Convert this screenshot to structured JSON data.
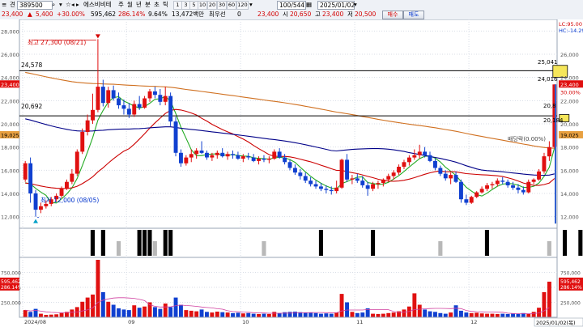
{
  "toolbar": {
    "menu_glyph": "≡",
    "period_prefix": "견",
    "code": "389500",
    "stock_name": "에스비비테",
    "period_tabs": [
      "주",
      "월",
      "년",
      "분",
      "초",
      "틱"
    ],
    "minute_buttons": [
      "1",
      "3",
      "5",
      "10",
      "20",
      "30",
      "60",
      "120"
    ],
    "count": "100/544",
    "date": "2025/01/02",
    "buy_label": "매수",
    "sell_label": "매도"
  },
  "quote": {
    "price": "23,400",
    "change": "5,400",
    "change_rate": "+30.00%",
    "volume": "595,462",
    "volume_ratio": "286.14%",
    "turnover_rate": "9.64%",
    "trade_value": "13,472백만",
    "priority_label": "최우선",
    "priority_value": "0",
    "open_label_value": "23,400",
    "high_label": "시",
    "high_value": "20,650",
    "close_label": "고",
    "close_value": "23,400",
    "low_label": "저",
    "low_value": "20,500"
  },
  "price_axis": {
    "left_ticks": [
      "28,000",
      "26,000",
      "24,000",
      "22,000",
      "20,000",
      "18,000",
      "16,000",
      "14,000",
      "12,000"
    ],
    "right_ticks": [
      "26,000",
      "24,000",
      "22,000",
      "20,000",
      "18,000",
      "16,000",
      "14,000",
      "12,000"
    ],
    "left_price_tag": "23,400",
    "left_ma_tag": "19,025",
    "right_price_tag": "23,400",
    "right_ma_tag": "19,025",
    "right_top_lc": "LC:95.00",
    "right_top_hc": "HC:-14.29",
    "right_pct": "30.00%",
    "right_mid": "22,000"
  },
  "annotations": {
    "high_note": "최고 27,300 (08/21)",
    "low_note": "최저 12,000 (08/05)",
    "upper_line_label": "24,578",
    "lower_line_label": "20,692",
    "box_high": "25,041",
    "box_low": "24,016",
    "small_box_high": "20,8",
    "small_box_low": "20,184",
    "dividend_note": "배당락(0.00%)"
  },
  "volume_axis": {
    "left_ticks": [
      "750,000",
      "500,000",
      "250,000"
    ],
    "right_ticks": [
      "750,000",
      "500,000",
      "250,000"
    ],
    "left_tag": "595,462",
    "left_tag2": "286.14%",
    "right_tag": "595,462",
    "right_tag2": "286.14%"
  },
  "date_axis": {
    "labels": [
      "2024/08",
      "09",
      "10",
      "11",
      "12"
    ],
    "right_tag": "2025/01/02(목)"
  },
  "chart_data": {
    "type": "candlestick",
    "candles": [
      [
        15200,
        16800,
        15000,
        16600
      ],
      [
        16600,
        17100,
        13200,
        14000
      ],
      [
        14000,
        14300,
        12000,
        12600
      ],
      [
        12600,
        13200,
        12300,
        12900
      ],
      [
        12900,
        13400,
        12700,
        13100
      ],
      [
        13100,
        13700,
        12900,
        13500
      ],
      [
        13500,
        14000,
        13300,
        13800
      ],
      [
        13800,
        14600,
        13600,
        14400
      ],
      [
        14400,
        15200,
        14300,
        15000
      ],
      [
        15000,
        16100,
        14800,
        15700
      ],
      [
        15700,
        17800,
        15500,
        17600
      ],
      [
        17600,
        19600,
        17400,
        19300
      ],
      [
        19300,
        20800,
        19000,
        20300
      ],
      [
        20300,
        22600,
        20000,
        21200
      ],
      [
        21200,
        27300,
        21000,
        23200
      ],
      [
        23200,
        23800,
        21500,
        21800
      ],
      [
        21800,
        23200,
        21400,
        22900
      ],
      [
        22900,
        23300,
        22000,
        22200
      ],
      [
        22200,
        22700,
        21300,
        21600
      ],
      [
        21600,
        22100,
        20800,
        21300
      ],
      [
        21300,
        21800,
        20500,
        20800
      ],
      [
        20800,
        22000,
        20600,
        21700
      ],
      [
        21700,
        22400,
        21200,
        21400
      ],
      [
        21400,
        22400,
        21300,
        22200
      ],
      [
        22200,
        23000,
        21900,
        22800
      ],
      [
        22800,
        23200,
        22200,
        22500
      ],
      [
        22500,
        23000,
        21600,
        21900
      ],
      [
        21900,
        23200,
        21600,
        22400
      ],
      [
        22400,
        22700,
        19800,
        20200
      ],
      [
        20200,
        20600,
        17200,
        17500
      ],
      [
        17500,
        17800,
        16300,
        16600
      ],
      [
        16600,
        17300,
        16400,
        17100
      ],
      [
        17100,
        17800,
        16700,
        17400
      ],
      [
        17400,
        17900,
        17000,
        17700
      ],
      [
        17700,
        18500,
        17400,
        17500
      ],
      [
        17500,
        17700,
        16900,
        17100
      ],
      [
        17100,
        17500,
        16800,
        17300
      ],
      [
        17300,
        17700,
        17000,
        17500
      ],
      [
        17500,
        17900,
        17100,
        17200
      ],
      [
        17200,
        17600,
        16900,
        17400
      ],
      [
        17400,
        17700,
        17000,
        17300
      ],
      [
        17300,
        17600,
        16900,
        17000
      ],
      [
        17000,
        17400,
        16700,
        17200
      ],
      [
        17200,
        17500,
        16900,
        17100
      ],
      [
        17100,
        17400,
        16700,
        16800
      ],
      [
        16800,
        17200,
        16500,
        17000
      ],
      [
        17000,
        17300,
        16700,
        16900
      ],
      [
        16900,
        17200,
        16600,
        17000
      ],
      [
        17000,
        17800,
        16900,
        17600
      ],
      [
        17600,
        17900,
        17000,
        17100
      ],
      [
        17100,
        17400,
        16500,
        16700
      ],
      [
        16700,
        16900,
        16000,
        16200
      ],
      [
        16200,
        16500,
        15600,
        15800
      ],
      [
        15800,
        16100,
        15200,
        15500
      ],
      [
        15500,
        15800,
        14900,
        15100
      ],
      [
        15100,
        15400,
        14600,
        14800
      ],
      [
        14800,
        15100,
        14400,
        14600
      ],
      [
        14600,
        14900,
        14200,
        14400
      ],
      [
        14400,
        14700,
        14000,
        14300
      ],
      [
        14300,
        14600,
        13900,
        14200
      ],
      [
        14200,
        15100,
        14000,
        14500
      ],
      [
        14500,
        17000,
        14400,
        16900
      ],
      [
        16900,
        17400,
        15000,
        15200
      ],
      [
        15200,
        15600,
        14800,
        15300
      ],
      [
        15300,
        15700,
        14900,
        15100
      ],
      [
        15100,
        15500,
        14500,
        14700
      ],
      [
        14700,
        15000,
        13800,
        14400
      ],
      [
        14400,
        15000,
        14200,
        14800
      ],
      [
        14800,
        15100,
        14400,
        14900
      ],
      [
        14900,
        15300,
        14600,
        15200
      ],
      [
        15200,
        15700,
        15000,
        15500
      ],
      [
        15500,
        16000,
        15200,
        15800
      ],
      [
        15800,
        16500,
        15600,
        16300
      ],
      [
        16300,
        16900,
        16100,
        16700
      ],
      [
        16700,
        17300,
        16400,
        17100
      ],
      [
        17100,
        17800,
        16900,
        17300
      ],
      [
        17300,
        18200,
        17000,
        17600
      ],
      [
        17600,
        18000,
        17100,
        17300
      ],
      [
        17300,
        17600,
        16700,
        16800
      ],
      [
        16800,
        17000,
        16000,
        16200
      ],
      [
        16200,
        16400,
        15500,
        15700
      ],
      [
        15700,
        16000,
        15100,
        15300
      ],
      [
        15300,
        15800,
        14800,
        15600
      ],
      [
        15600,
        15900,
        14900,
        15000
      ],
      [
        15000,
        15200,
        13200,
        13500
      ],
      [
        13500,
        13900,
        13000,
        13200
      ],
      [
        13200,
        13800,
        13100,
        13700
      ],
      [
        13700,
        14200,
        13600,
        14100
      ],
      [
        14100,
        14600,
        14000,
        14400
      ],
      [
        14400,
        14900,
        14200,
        14700
      ],
      [
        14700,
        15000,
        14400,
        14800
      ],
      [
        14800,
        15300,
        14600,
        15100
      ],
      [
        15100,
        15400,
        14800,
        15000
      ],
      [
        15000,
        15200,
        14500,
        14700
      ],
      [
        14700,
        15000,
        14300,
        14500
      ],
      [
        14500,
        14800,
        14000,
        14300
      ],
      [
        14300,
        14600,
        13900,
        14100
      ],
      [
        14100,
        15200,
        14000,
        15000
      ],
      [
        15000,
        15300,
        14800,
        15200
      ],
      [
        15200,
        16100,
        15100,
        15900
      ],
      [
        15900,
        17500,
        15700,
        17200
      ],
      [
        17200,
        18500,
        16800,
        18000
      ],
      [
        18000,
        23400,
        17900,
        23400
      ]
    ],
    "ylim": [
      11000,
      29000
    ],
    "moving_averages": [
      {
        "name": "ma5",
        "color": "#22aa22"
      },
      {
        "name": "ma20",
        "color": "#cc0000"
      },
      {
        "name": "ma60",
        "color": "#000088"
      },
      {
        "name": "ma120",
        "color": "#d07020"
      }
    ],
    "volumes": [
      120,
      90,
      140,
      60,
      40,
      45,
      50,
      70,
      90,
      130,
      170,
      260,
      330,
      380,
      960,
      420,
      260,
      210,
      150,
      130,
      120,
      200,
      160,
      180,
      250,
      170,
      140,
      230,
      170,
      330,
      210,
      120,
      110,
      100,
      130,
      90,
      80,
      95,
      85,
      80,
      70,
      75,
      65,
      70,
      60,
      55,
      60,
      55,
      90,
      70,
      85,
      90,
      95,
      85,
      80,
      75,
      70,
      60,
      65,
      60,
      80,
      390,
      250,
      90,
      70,
      80,
      150,
      60,
      55,
      60,
      70,
      80,
      100,
      130,
      180,
      400,
      210,
      130,
      100,
      90,
      70,
      60,
      80,
      200,
      110,
      80,
      70,
      75,
      65,
      60,
      60,
      55,
      60,
      55,
      60,
      55,
      70,
      60,
      90,
      160,
      420,
      595
    ],
    "volume_ylim": [
      0,
      1000
    ],
    "signals": {
      "black": [
        13,
        15,
        22,
        23,
        24,
        27,
        28,
        57,
        67,
        89,
        104,
        107
      ],
      "gray": [
        18,
        25,
        46,
        80,
        101
      ]
    }
  }
}
